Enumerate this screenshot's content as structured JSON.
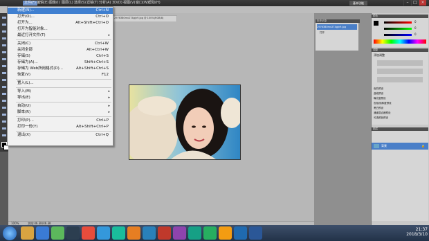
{
  "menubar": {
    "items": [
      "文件(F)",
      "编辑(E)",
      "图像(I)",
      "图层(L)",
      "选择(S)",
      "滤镜(T)",
      "分析(A)",
      "3D(D)",
      "视图(V)",
      "窗口(W)",
      "帮助(H)"
    ],
    "essentials": "基本功能"
  },
  "document": {
    "tab_title": "2976380mv274gjn9.jpg @ 100%(RGB/8)",
    "zoom": "100%",
    "doc_size": "文档:46.3K/46.3K"
  },
  "file_menu": {
    "items": [
      {
        "label": "新建(N)...",
        "shortcut": "Ctrl+N"
      },
      {
        "label": "打开(O)...",
        "shortcut": "Ctrl+O"
      },
      {
        "label": "打开为...",
        "shortcut": "Alt+Shift+Ctrl+O"
      },
      {
        "label": "打开为智能对象...",
        "shortcut": ""
      },
      {
        "label": "最近打开文件(T)",
        "shortcut": ""
      },
      {
        "label": "关闭(C)",
        "shortcut": "Ctrl+W"
      },
      {
        "label": "关闭全部",
        "shortcut": "Alt+Ctrl+W"
      },
      {
        "label": "存储(S)",
        "shortcut": "Ctrl+S"
      },
      {
        "label": "存储为(A)...",
        "shortcut": "Shift+Ctrl+S"
      },
      {
        "label": "存储为 Web所用格式(D)...",
        "shortcut": "Alt+Shift+Ctrl+S"
      },
      {
        "label": "恢复(V)",
        "shortcut": "F12"
      },
      {
        "label": "置入(L)...",
        "shortcut": ""
      },
      {
        "label": "导入(M)",
        "shortcut": ""
      },
      {
        "label": "导出(E)",
        "shortcut": ""
      },
      {
        "label": "自动(U)",
        "shortcut": ""
      },
      {
        "label": "脚本(R)",
        "shortcut": ""
      },
      {
        "label": "打印(P)...",
        "shortcut": "Ctrl+P"
      },
      {
        "label": "打印一份(Y)",
        "shortcut": "Alt+Shift+Ctrl+P"
      },
      {
        "label": "退出(X)",
        "shortcut": "Ctrl+Q"
      }
    ]
  },
  "history_panel": {
    "tabs": [
      "历史记录",
      "动作"
    ],
    "snapshot": "2976380mv274gjn9.jpg",
    "step": "打开"
  },
  "color_panel": {
    "tabs": [
      "颜色",
      "色板",
      "样式"
    ],
    "r": "0",
    "g": "0",
    "b": "0"
  },
  "adjustments_panel": {
    "tabs": [
      "调整",
      "蒙版"
    ],
    "title": "添加调整",
    "presets": [
      "色阶预设",
      "曲线预设",
      "曝光度预设",
      "色相/饱和度预设",
      "黑白预设",
      "通道混合器预设",
      "可选颜色预设"
    ]
  },
  "layers_panel": {
    "tabs": [
      "图层",
      "通道",
      "路径"
    ],
    "layer_name": "背景"
  },
  "taskbar": {
    "time": "21:37",
    "date": "2018/3/10"
  }
}
